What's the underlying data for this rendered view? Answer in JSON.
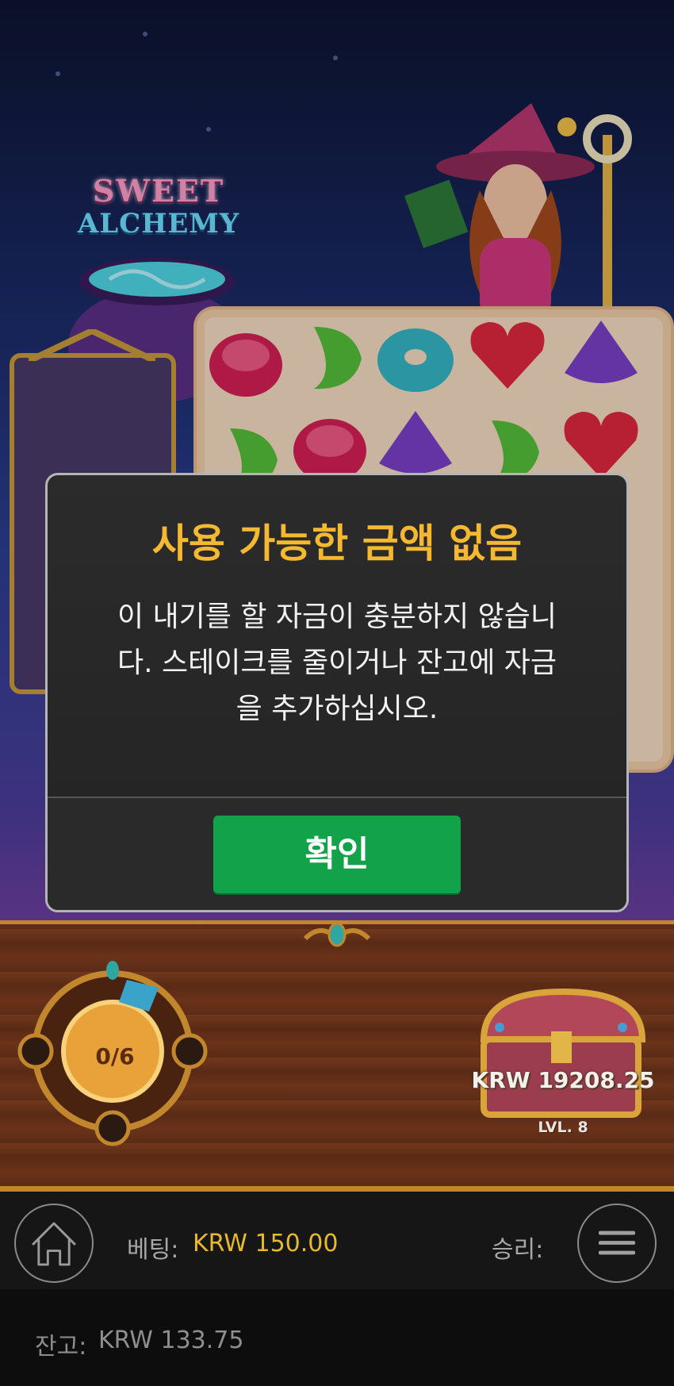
{
  "game": {
    "logo_line1": "SWEET",
    "logo_line2": "ALCHEMY"
  },
  "modal": {
    "title": "사용 가능한 금액 없음",
    "body_line1": "이 내기를 할 자금이 충분하지 않습니",
    "body_line2": "다. 스테이크를 줄이거나 잔고에 자금",
    "body_line3": "을 추가하십시오.",
    "confirm_label": "확인"
  },
  "gauge": {
    "progress_text": "0/6",
    "progress_fraction": 0.0
  },
  "chest": {
    "amount": "KRW 19208.25",
    "level": "LVL. 8"
  },
  "bottom_bar": {
    "bet_label": "베팅:",
    "bet_value": "KRW 150.00",
    "win_label": "승리:",
    "balance_label": "잔고:",
    "balance_value": "KRW 133.75"
  },
  "icons": {
    "home": "home-icon",
    "menu": "hamburger-menu-icon"
  },
  "colors": {
    "title_gold": "#f5b931",
    "confirm_green": "#11a24a",
    "bet_gold": "#e8b92a",
    "wood": "#6a3219"
  }
}
